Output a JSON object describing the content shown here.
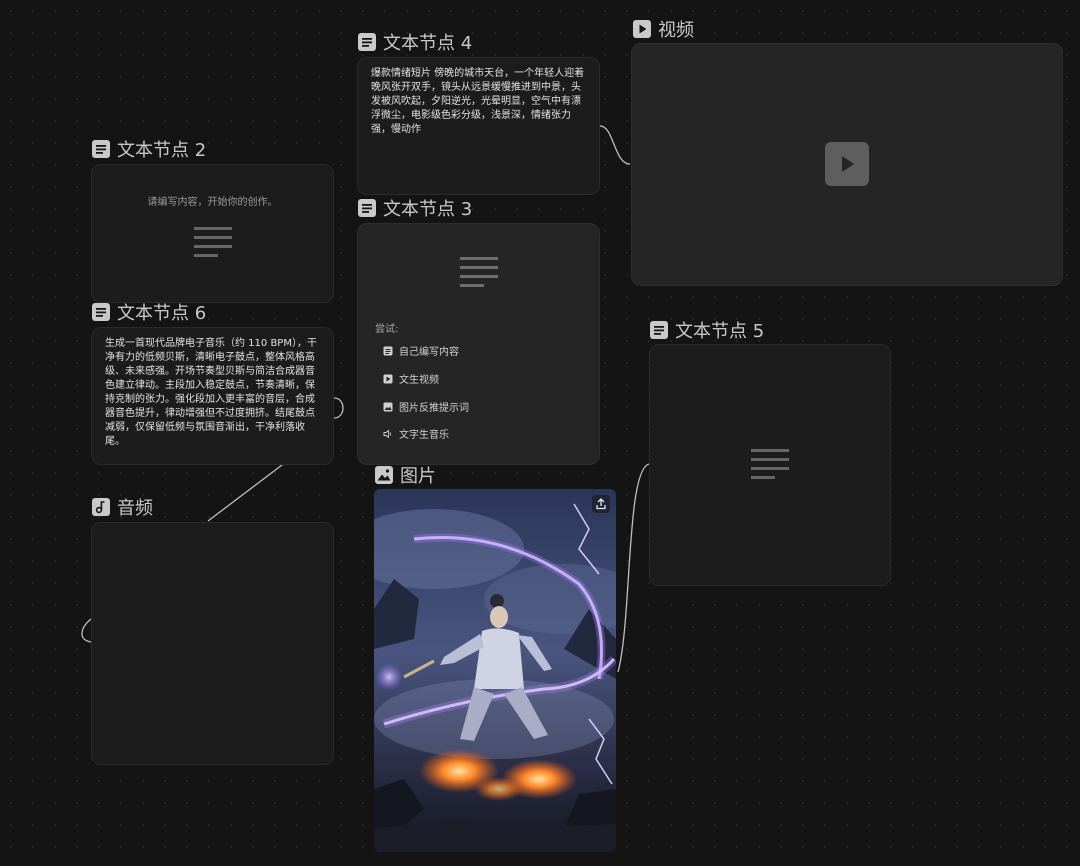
{
  "nodes": {
    "text4": {
      "title": "文本节点 4",
      "content": "爆款情绪短片 傍晚的城市天台，一个年轻人迎着晚风张开双手，镜头从远景缓慢推进到中景，头发被风吹起，夕阳逆光，光晕明显，空气中有漂浮微尘，电影级色彩分级，浅景深，情绪张力强，慢动作"
    },
    "text2": {
      "title": "文本节点 2",
      "placeholder": "请编写内容，开始你的创作。"
    },
    "text3": {
      "title": "文本节点 3",
      "try_label": "尝试:",
      "suggestions": [
        "自己编写内容",
        "文生视频",
        "图片反推提示词",
        "文字生音乐"
      ],
      "suggestion_icons": [
        "doc-icon",
        "play-icon",
        "image-icon",
        "speaker-icon"
      ]
    },
    "text6": {
      "title": "文本节点 6",
      "content": "生成一首现代品牌电子音乐（约 110 BPM），干净有力的低频贝斯，清晰电子鼓点，整体风格高级、未来感强。开场节奏型贝斯与简洁合成器音色建立律动。主段加入稳定鼓点，节奏清晰，保持克制的张力。强化段加入更丰富的音层，合成器音色提升，律动增强但不过度拥挤。结尾鼓点减弱，仅保留低频与氛围音渐出，干净利落收尾。"
    },
    "audio": {
      "title": "音频"
    },
    "image": {
      "title": "图片"
    },
    "video": {
      "title": "视频"
    },
    "text5": {
      "title": "文本节点 5"
    }
  },
  "colors": {
    "background": "#141414",
    "card": "#1c1c1c",
    "card_light": "#252525",
    "edge": "#bfbfbf",
    "lightning": "#c9a8ff"
  }
}
